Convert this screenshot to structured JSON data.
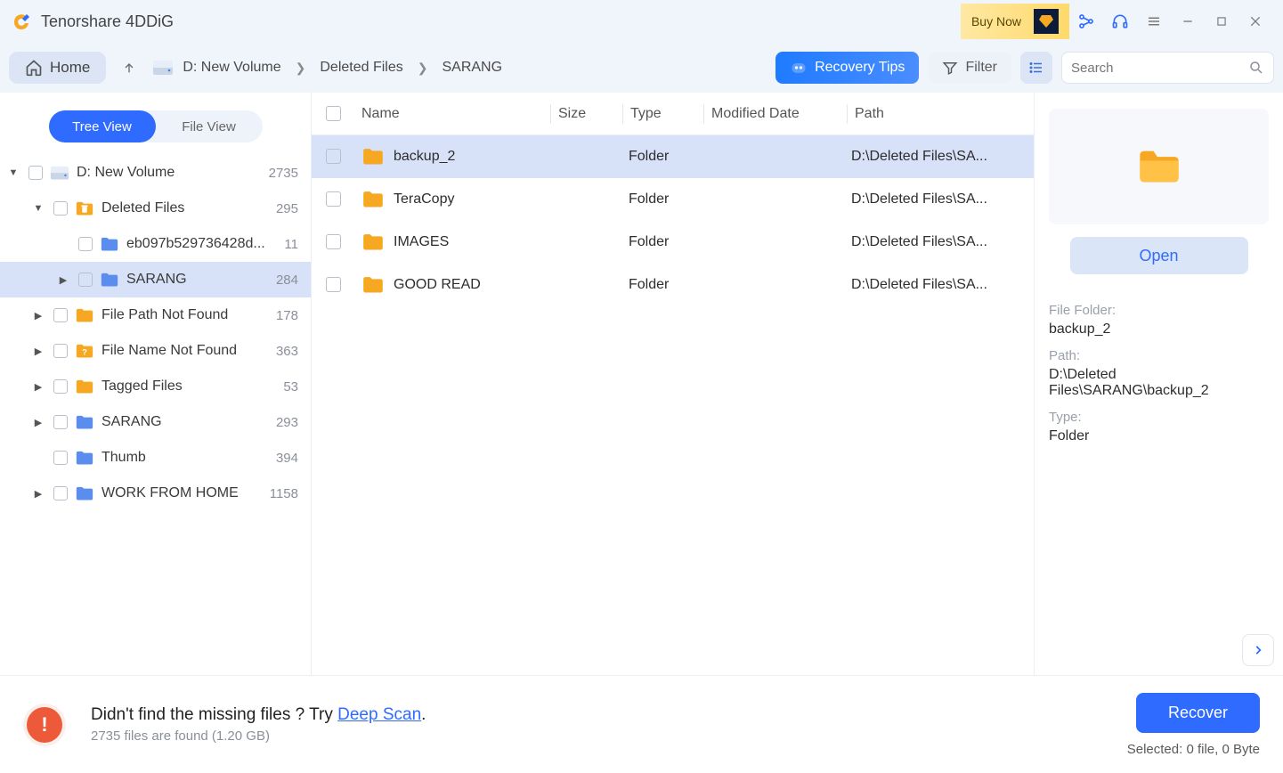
{
  "app": {
    "title": "Tenorshare 4DDiG",
    "buy_now": "Buy Now"
  },
  "toolbar": {
    "home": "Home",
    "crumbs": [
      "D: New Volume",
      "Deleted Files",
      "SARANG"
    ],
    "recovery_tips": "Recovery Tips",
    "filter": "Filter",
    "search_placeholder": "Search"
  },
  "view_toggle": {
    "tree": "Tree View",
    "file": "File View"
  },
  "tree": [
    {
      "depth": 0,
      "caret": "down",
      "icon": "drive",
      "label": "D: New Volume",
      "count": "2735"
    },
    {
      "depth": 1,
      "caret": "down",
      "icon": "trash-folder",
      "label": "Deleted Files",
      "count": "295"
    },
    {
      "depth": 2,
      "caret": "",
      "icon": "blue-folder",
      "label": "eb097b529736428d...",
      "count": "11"
    },
    {
      "depth": 2,
      "caret": "right",
      "icon": "blue-folder",
      "label": "SARANG",
      "count": "284",
      "selected": true
    },
    {
      "depth": 1,
      "caret": "right",
      "icon": "yellow-folder",
      "label": "File Path Not Found",
      "count": "178"
    },
    {
      "depth": 1,
      "caret": "right",
      "icon": "q-folder",
      "label": "File Name Not Found",
      "count": "363"
    },
    {
      "depth": 1,
      "caret": "right",
      "icon": "yellow-folder",
      "label": "Tagged Files",
      "count": "53"
    },
    {
      "depth": 1,
      "caret": "right",
      "icon": "blue-folder",
      "label": "SARANG",
      "count": "293"
    },
    {
      "depth": 1,
      "caret": "",
      "icon": "blue-folder",
      "label": "Thumb",
      "count": "394"
    },
    {
      "depth": 1,
      "caret": "right",
      "icon": "blue-folder",
      "label": "WORK FROM HOME",
      "count": "1158"
    }
  ],
  "columns": {
    "name": "Name",
    "size": "Size",
    "type": "Type",
    "modified": "Modified Date",
    "path": "Path"
  },
  "files": [
    {
      "name": "backup_2",
      "size": "",
      "type": "Folder",
      "modified": "",
      "path": "D:\\Deleted Files\\SA...",
      "selected": true
    },
    {
      "name": "TeraCopy",
      "size": "",
      "type": "Folder",
      "modified": "",
      "path": "D:\\Deleted Files\\SA..."
    },
    {
      "name": "IMAGES",
      "size": "",
      "type": "Folder",
      "modified": "",
      "path": "D:\\Deleted Files\\SA..."
    },
    {
      "name": "GOOD READ",
      "size": "",
      "type": "Folder",
      "modified": "",
      "path": "D:\\Deleted Files\\SA..."
    }
  ],
  "details": {
    "open": "Open",
    "labels": {
      "folder": "File Folder:",
      "path": "Path:",
      "type": "Type:"
    },
    "values": {
      "folder": "backup_2",
      "path": "D:\\Deleted Files\\SARANG\\backup_2",
      "type": "Folder"
    }
  },
  "footer": {
    "line1_a": "Didn't find the missing files ? Try ",
    "deep_scan": "Deep Scan",
    "line1_b": ".",
    "line2": "2735 files are found (1.20 GB)",
    "recover": "Recover",
    "selected": "Selected: 0 file, 0 Byte"
  }
}
